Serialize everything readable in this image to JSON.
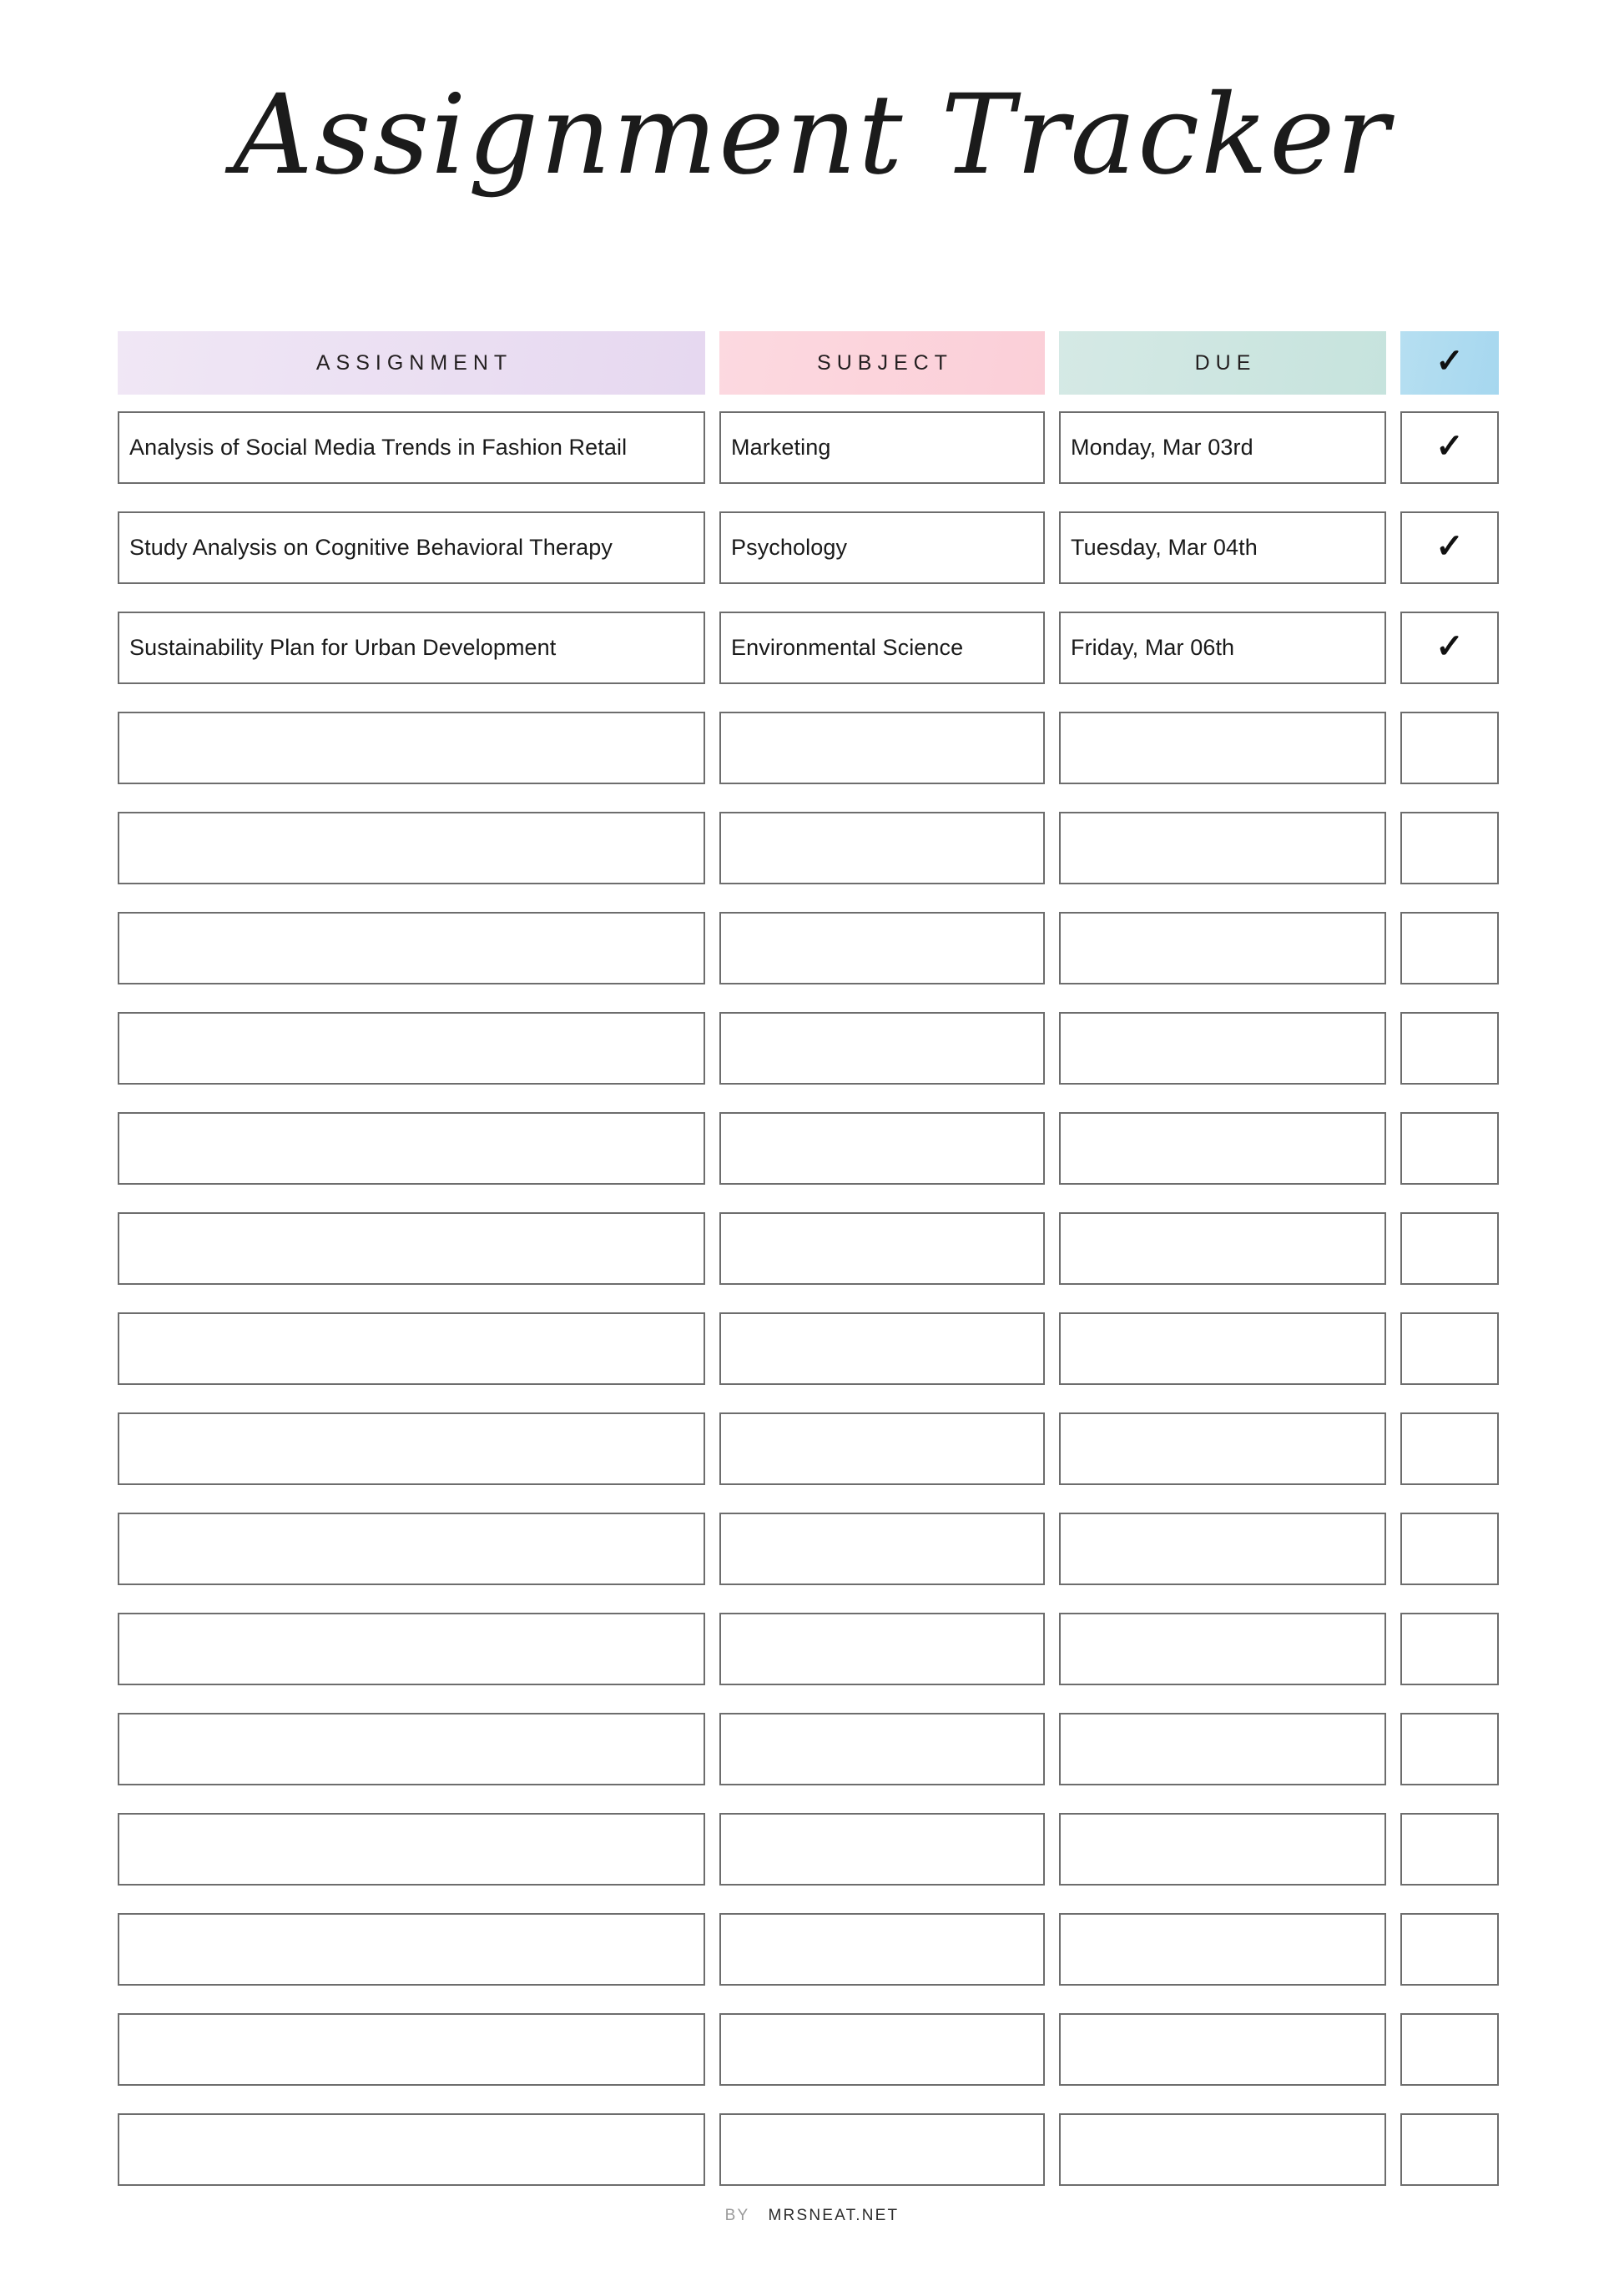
{
  "page": {
    "title": "Assignment Tracker",
    "background_color": "#ffffff"
  },
  "table": {
    "headers": {
      "assignment": "ASSIGNMENT",
      "subject": "SUBJECT",
      "due": "DUE",
      "check": "✓"
    },
    "header_colors": {
      "assignment": "#EDE3F2",
      "subject": "#FBD4DC",
      "due": "#CEE7E3",
      "check": "#AFDCF0"
    },
    "border_color": "#6d6d6d",
    "check_glyph": "✓",
    "total_rows": 18,
    "rows": [
      {
        "assignment": "Analysis of Social Media Trends in Fashion Retail",
        "subject": "Marketing",
        "due": "Monday, Mar 03rd",
        "done": true
      },
      {
        "assignment": "Study Analysis on Cognitive Behavioral Therapy",
        "subject": "Psychology",
        "due": "Tuesday, Mar 04th",
        "done": true
      },
      {
        "assignment": "Sustainability Plan for Urban Development",
        "subject": "Environmental Science",
        "due": "Friday, Mar 06th",
        "done": true
      },
      {
        "assignment": "",
        "subject": "",
        "due": "",
        "done": false
      },
      {
        "assignment": "",
        "subject": "",
        "due": "",
        "done": false
      },
      {
        "assignment": "",
        "subject": "",
        "due": "",
        "done": false
      },
      {
        "assignment": "",
        "subject": "",
        "due": "",
        "done": false
      },
      {
        "assignment": "",
        "subject": "",
        "due": "",
        "done": false
      },
      {
        "assignment": "",
        "subject": "",
        "due": "",
        "done": false
      },
      {
        "assignment": "",
        "subject": "",
        "due": "",
        "done": false
      },
      {
        "assignment": "",
        "subject": "",
        "due": "",
        "done": false
      },
      {
        "assignment": "",
        "subject": "",
        "due": "",
        "done": false
      },
      {
        "assignment": "",
        "subject": "",
        "due": "",
        "done": false
      },
      {
        "assignment": "",
        "subject": "",
        "due": "",
        "done": false
      },
      {
        "assignment": "",
        "subject": "",
        "due": "",
        "done": false
      },
      {
        "assignment": "",
        "subject": "",
        "due": "",
        "done": false
      },
      {
        "assignment": "",
        "subject": "",
        "due": "",
        "done": false
      },
      {
        "assignment": "",
        "subject": "",
        "due": "",
        "done": false
      }
    ]
  },
  "footer": {
    "by_label": "BY",
    "site_label": "MRSNEAT.NET"
  }
}
